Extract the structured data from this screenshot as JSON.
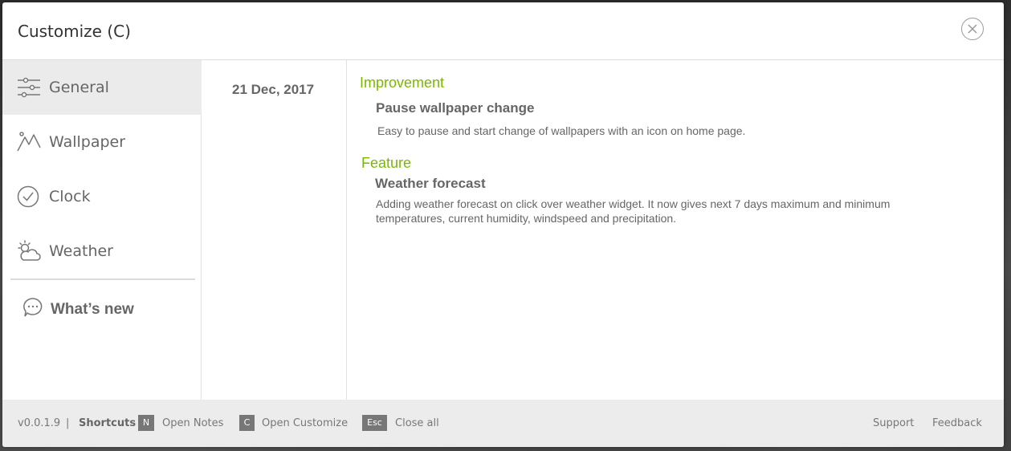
{
  "modal": {
    "title": "Customize (C)"
  },
  "sidebar": {
    "items": [
      {
        "label": "General",
        "icon": "sliders-icon",
        "active": true
      },
      {
        "label": "Wallpaper",
        "icon": "mountain-icon",
        "active": false
      },
      {
        "label": "Clock",
        "icon": "check-circle-icon",
        "active": false
      },
      {
        "label": "Weather",
        "icon": "sun-cloud-icon",
        "active": false
      }
    ],
    "whats_new": {
      "label": "What’s new",
      "icon": "chat-bubble-icon"
    }
  },
  "release": {
    "date": "21 Dec, 2017",
    "entries": [
      {
        "category": "Improvement",
        "title": "Pause wallpaper change",
        "description": "Easy to pause and start change of wallpapers with an icon on home page."
      },
      {
        "category": "Feature",
        "title": "Weather forecast",
        "description": "Adding weather forecast on click over weather widget. It now gives next 7 days maximum and minimum temperatures, current humidity, windspeed and precipitation."
      }
    ]
  },
  "footer": {
    "version": "v0.0.1.9",
    "separator": "|",
    "shortcuts_label": "Shortcuts",
    "shortcuts": [
      {
        "key": "N",
        "label": "Open Notes"
      },
      {
        "key": "C",
        "label": "Open Customize"
      },
      {
        "key": "Esc",
        "label": "Close all"
      }
    ],
    "support": "Support",
    "feedback": "Feedback"
  },
  "colors": {
    "accent_green": "#7ab800",
    "text_gray": "#666666",
    "active_bg": "#ebebeb",
    "footer_bg": "#ececec"
  }
}
